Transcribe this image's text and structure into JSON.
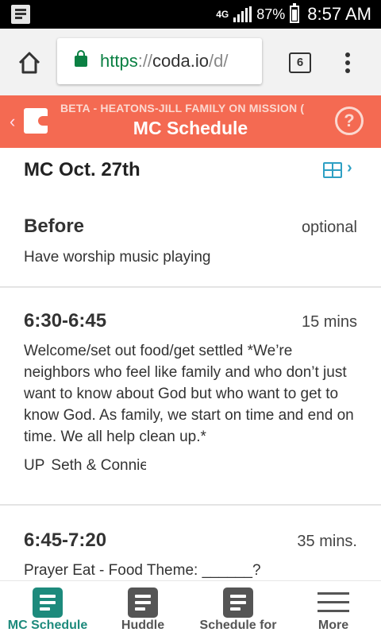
{
  "status_bar": {
    "network": "4G",
    "battery": "87%",
    "time": "8:57 AM"
  },
  "browser": {
    "url_scheme": "https",
    "url_sep": "://",
    "url_host": "coda.io",
    "url_path": "/d/",
    "tab_count": "6"
  },
  "doc_header": {
    "folder": "BETA - HEATONS-JILL FAMILY ON MISSION (",
    "title": "MC Schedule",
    "back_icon": "chevron-left-icon",
    "help_icon": "question-circle-icon",
    "help_glyph": "?",
    "color": "#f46a52"
  },
  "section": {
    "title": "MC Oct. 27th",
    "view_icon": "table-icon"
  },
  "schedule": [
    {
      "time": "Before",
      "duration": "optional",
      "description": "Have worship music playing"
    },
    {
      "time": "6:30-6:45",
      "duration": "15 mins",
      "description": "Welcome/set out food/get settled *We’re neighbors who feel like family and who don’t just want to know about God but who want to get to know God. As family, we start on time and end on time. We all help clean up.*",
      "role": "UP",
      "people": "Seth & Connie"
    },
    {
      "time": "6:45-7:20",
      "duration": "35 mins.",
      "description": "Prayer Eat - Food Theme: ______?"
    }
  ],
  "bottom_nav": [
    {
      "label": "MC Schedule",
      "icon": "doc-icon",
      "active": true
    },
    {
      "label": "Huddle",
      "icon": "doc-icon",
      "active": false
    },
    {
      "label": "Schedule for",
      "icon": "doc-icon",
      "active": false
    },
    {
      "label": "More",
      "icon": "hamburger-icon",
      "active": false
    }
  ],
  "colors": {
    "accent": "#1d8a7c",
    "link": "#2ea0c4",
    "secure": "#0b8043"
  }
}
